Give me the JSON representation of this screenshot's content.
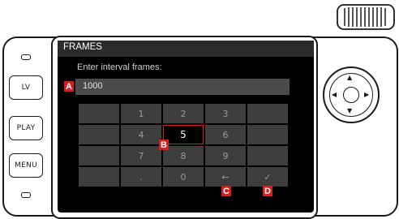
{
  "header": {
    "title": "FRAMES"
  },
  "prompt": "Enter interval frames:",
  "field": {
    "value": "1000"
  },
  "keypad": {
    "rows": [
      [
        "",
        "1",
        "2",
        "3",
        ""
      ],
      [
        "",
        "4",
        "5",
        "6",
        ""
      ],
      [
        "",
        "7",
        "8",
        "9",
        ""
      ],
      [
        "",
        ".",
        "0",
        "←",
        "✓"
      ]
    ],
    "selected": "5"
  },
  "markers": {
    "a": "A",
    "b": "B",
    "c": "C",
    "d": "D"
  },
  "side_buttons": {
    "lv": "LV",
    "play": "PLAY",
    "menu": "MENU"
  },
  "dial_arrows": {
    "up": "▲",
    "down": "▼",
    "left": "◀",
    "right": "▶"
  },
  "icons": {
    "thumbwheel": "thumbwheel-icon",
    "dial": "navigation-dial-icon"
  },
  "colors": {
    "screen": "#000000",
    "key": "#3d3d3d",
    "selected_border": "#d42020",
    "marker": "#d61e1e"
  }
}
